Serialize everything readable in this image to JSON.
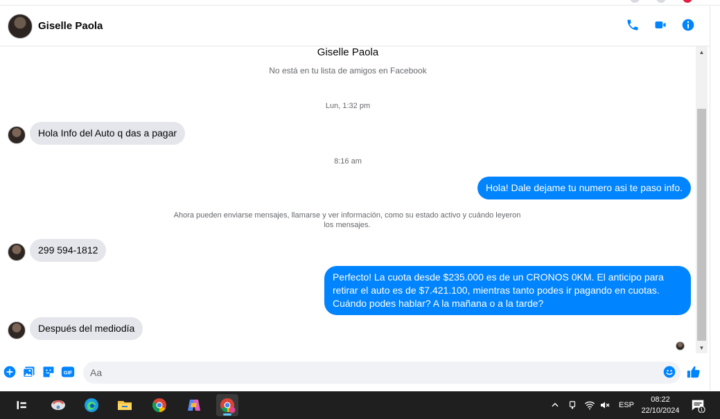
{
  "header": {
    "contact_name": "Giselle Paola"
  },
  "thread": {
    "name": "Giselle Paola",
    "subtitle": "No está en tu lista de amigos en Facebook",
    "timestamp_1": "Lun, 1:32 pm",
    "timestamp_2": "8:16 am",
    "system_message": "Ahora pueden enviarse mensajes, llamarse y ver información, como su estado activo y cuándo leyeron los mensajes.",
    "messages": [
      {
        "direction": "in",
        "text": "Hola Info del Auto q das a pagar"
      },
      {
        "direction": "out",
        "text": "Hola! Dale  dejame tu numero asi te paso info."
      },
      {
        "direction": "in",
        "text": "299 594-1812"
      },
      {
        "direction": "out",
        "text": "Perfecto! La cuota desde $235.000 es de un CRONOS 0KM. El anticipo para retirar el auto es de $7.421.100, mientras tanto podes ir pagando en cuotas. Cuándo podes hablar? A la mañana o a la tarde?"
      },
      {
        "direction": "in",
        "text": "Después del mediodía"
      }
    ]
  },
  "composer": {
    "placeholder": "Aa",
    "gif_label": "GIF"
  },
  "taskbar": {
    "language": "ESP",
    "time": "08:22",
    "date": "22/10/2024",
    "notification_count": "1"
  },
  "colors": {
    "accent": "#0084ff",
    "incoming_bubble": "#e4e6eb",
    "taskbar": "#1f1f1f"
  },
  "icons": [
    "phone-icon",
    "video-icon",
    "info-icon",
    "plus-icon",
    "image-icon",
    "sticker-icon",
    "gif-icon",
    "emoji-icon",
    "thumbs-up-icon"
  ]
}
